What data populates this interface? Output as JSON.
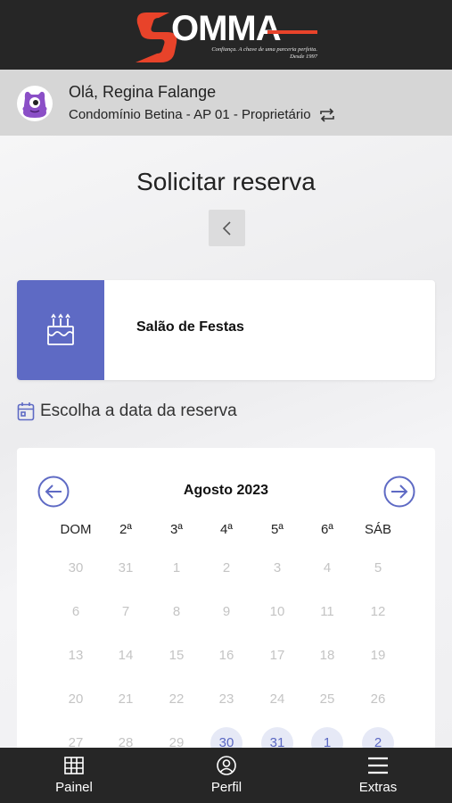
{
  "brand": {
    "name": "OMMA",
    "tagline": "Confiança. A chave de uma parceria perfeita.",
    "since": "Desde 1997",
    "colors": {
      "accent": "#e8432a",
      "dark": "#262626",
      "primary": "#5e6ac4"
    }
  },
  "user": {
    "greeting": "Olá, Regina Falange",
    "condo": "Condomínio Betina - AP 01 - Proprietário",
    "avatar_icon": "monster-avatar-icon",
    "switch_icon": "swap-icon"
  },
  "page": {
    "title": "Solicitar reserva",
    "back_icon": "chevron-left-icon"
  },
  "place": {
    "name": "Salão de Festas",
    "icon": "cake-icon"
  },
  "date_prompt": {
    "label": "Escolha a data da reserva",
    "icon": "calendar-icon"
  },
  "calendar": {
    "month": "Agosto 2023",
    "prev_icon": "arrow-left-circle-icon",
    "next_icon": "arrow-right-circle-icon",
    "weekdays": [
      "DOM",
      "2ª",
      "3ª",
      "4ª",
      "5ª",
      "6ª",
      "SÁB"
    ],
    "weeks": [
      [
        {
          "d": "30",
          "avail": false
        },
        {
          "d": "31",
          "avail": false
        },
        {
          "d": "1",
          "avail": false
        },
        {
          "d": "2",
          "avail": false
        },
        {
          "d": "3",
          "avail": false
        },
        {
          "d": "4",
          "avail": false
        },
        {
          "d": "5",
          "avail": false
        }
      ],
      [
        {
          "d": "6",
          "avail": false
        },
        {
          "d": "7",
          "avail": false
        },
        {
          "d": "8",
          "avail": false
        },
        {
          "d": "9",
          "avail": false
        },
        {
          "d": "10",
          "avail": false
        },
        {
          "d": "11",
          "avail": false
        },
        {
          "d": "12",
          "avail": false
        }
      ],
      [
        {
          "d": "13",
          "avail": false
        },
        {
          "d": "14",
          "avail": false
        },
        {
          "d": "15",
          "avail": false
        },
        {
          "d": "16",
          "avail": false
        },
        {
          "d": "17",
          "avail": false
        },
        {
          "d": "18",
          "avail": false
        },
        {
          "d": "19",
          "avail": false
        }
      ],
      [
        {
          "d": "20",
          "avail": false
        },
        {
          "d": "21",
          "avail": false
        },
        {
          "d": "22",
          "avail": false
        },
        {
          "d": "23",
          "avail": false
        },
        {
          "d": "24",
          "avail": false
        },
        {
          "d": "25",
          "avail": false
        },
        {
          "d": "26",
          "avail": false
        }
      ],
      [
        {
          "d": "27",
          "avail": false
        },
        {
          "d": "28",
          "avail": false
        },
        {
          "d": "29",
          "avail": false
        },
        {
          "d": "30",
          "avail": true
        },
        {
          "d": "31",
          "avail": true
        },
        {
          "d": "1",
          "avail": true
        },
        {
          "d": "2",
          "avail": true
        }
      ]
    ]
  },
  "bottom_nav": {
    "items": [
      {
        "label": "Painel",
        "icon": "grid-icon"
      },
      {
        "label": "Perfil",
        "icon": "user-circle-icon"
      },
      {
        "label": "Extras",
        "icon": "menu-icon"
      }
    ]
  }
}
